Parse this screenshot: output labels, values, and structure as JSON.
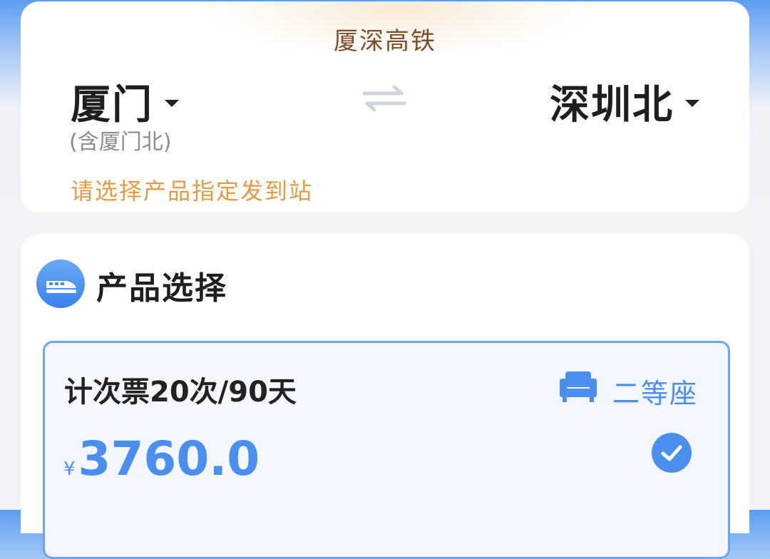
{
  "route": {
    "title": "厦深高铁",
    "from": {
      "name": "厦门",
      "note": "(含厦门北)"
    },
    "to": {
      "name": "深圳北"
    },
    "hint": "请选择产品指定发到站"
  },
  "products": {
    "section_title": "产品选择",
    "items": [
      {
        "name": "计次票20次/90天",
        "seat_type": "二等座",
        "currency": "¥",
        "price": "3760.0",
        "selected": true
      }
    ]
  },
  "colors": {
    "accent": "#4a8ff0",
    "hint": "#e59b42",
    "title": "#7a4e2a"
  },
  "icons": {
    "swap": "swap-arrows-icon",
    "section": "train-icon",
    "seat": "seat-icon",
    "check": "check-circle-icon"
  }
}
